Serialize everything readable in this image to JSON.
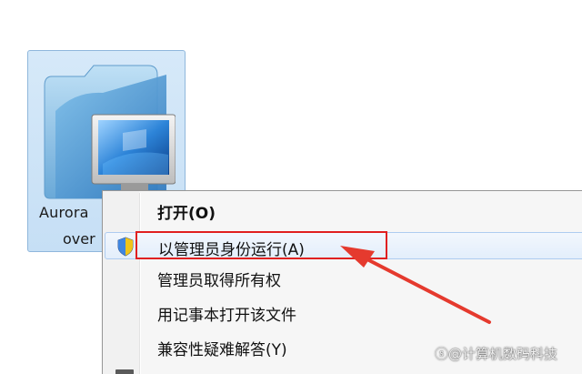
{
  "file": {
    "label_line1": "Aurora",
    "label_line2": "over",
    "icon": "folder-with-monitor-icon"
  },
  "context_menu": {
    "items": [
      {
        "label": "打开(O)",
        "bold": true,
        "icon": null
      },
      {
        "label": "以管理员身份运行(A)",
        "bold": false,
        "icon": "uac-shield-icon",
        "highlighted": true
      },
      {
        "label": "管理员取得所有权",
        "bold": false,
        "icon": null
      },
      {
        "label": "用记事本打开该文件",
        "bold": false,
        "icon": null
      },
      {
        "label": "兼容性疑难解答(Y)",
        "bold": false,
        "icon": null
      }
    ]
  },
  "annotation": {
    "box_color": "#e02020",
    "arrow_color": "#e53a2e"
  },
  "watermark": {
    "text": "@计算机数码科技"
  },
  "colors": {
    "selection_bg": "#cce4f7",
    "selection_border": "#8fb7dc",
    "menu_bg": "#f6f6f6"
  }
}
